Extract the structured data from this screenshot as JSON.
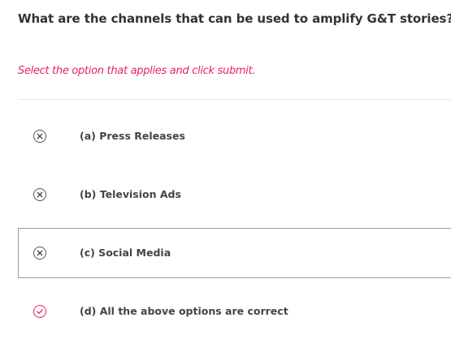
{
  "question": {
    "text": "What are the channels that can be used to amplify G&T stories?"
  },
  "instruction": {
    "text": "Select the option that applies and click submit."
  },
  "options": [
    {
      "label": "(a) Press Releases",
      "status": "incorrect",
      "selected": false
    },
    {
      "label": "(b) Television Ads",
      "status": "incorrect",
      "selected": false
    },
    {
      "label": "(c) Social Media",
      "status": "incorrect",
      "selected": true
    },
    {
      "label": "(d) All the above options are correct",
      "status": "correct",
      "selected": false
    }
  ],
  "colors": {
    "instruction": "#e6206d",
    "correct_icon": "#e6206d",
    "incorrect_icon": "#555555",
    "selected_border": "#999999"
  },
  "icons": {
    "incorrect": "x-circle-icon",
    "correct": "check-circle-icon"
  }
}
